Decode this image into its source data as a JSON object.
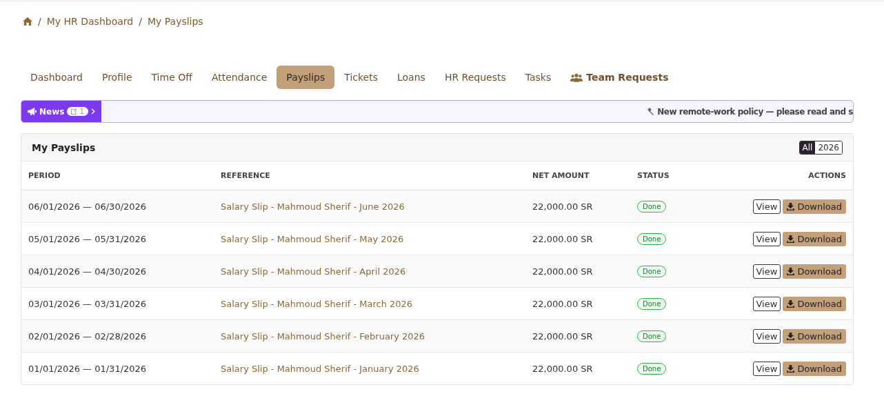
{
  "breadcrumb": [
    {
      "separator": "/",
      "label": "My HR Dashboard"
    },
    {
      "separator": "/",
      "label": "My Payslips"
    }
  ],
  "tabs": [
    {
      "label": "Dashboard",
      "selected": false,
      "kind": "plain"
    },
    {
      "label": "Profile",
      "selected": false,
      "kind": "plain"
    },
    {
      "label": "Time Off",
      "selected": false,
      "kind": "plain"
    },
    {
      "label": "Attendance",
      "selected": false,
      "kind": "plain"
    },
    {
      "label": "Payslips",
      "selected": true,
      "kind": "plain"
    },
    {
      "label": "Tickets",
      "selected": false,
      "kind": "plain"
    },
    {
      "label": "Loans",
      "selected": false,
      "kind": "plain"
    },
    {
      "label": "HR Requests",
      "selected": false,
      "kind": "plain"
    },
    {
      "label": "Tasks",
      "selected": false,
      "kind": "plain"
    },
    {
      "label": "Team Requests",
      "selected": false,
      "kind": "team"
    }
  ],
  "news": {
    "label": "News",
    "count": "1",
    "ticker": "New remote-work policy — please read and s"
  },
  "card": {
    "title": "My Payslips",
    "filters": [
      {
        "label": "All",
        "selected": true
      },
      {
        "label": "2026",
        "selected": false
      }
    ]
  },
  "table": {
    "columns": [
      "PERIOD",
      "REFERENCE",
      "NET AMOUNT",
      "STATUS",
      "ACTIONS"
    ],
    "rows": [
      {
        "period": "06/01/2026 — 06/30/2026",
        "reference": "Salary Slip - Mahmoud Sherif - June 2026",
        "amount": "22,000.00 SR",
        "status": "Done",
        "view": "View",
        "download": "Download"
      },
      {
        "period": "05/01/2026 — 05/31/2026",
        "reference": "Salary Slip - Mahmoud Sherif - May 2026",
        "amount": "22,000.00 SR",
        "status": "Done",
        "view": "View",
        "download": "Download"
      },
      {
        "period": "04/01/2026 — 04/30/2026",
        "reference": "Salary Slip - Mahmoud Sherif - April 2026",
        "amount": "22,000.00 SR",
        "status": "Done",
        "view": "View",
        "download": "Download"
      },
      {
        "period": "03/01/2026 — 03/31/2026",
        "reference": "Salary Slip - Mahmoud Sherif - March 2026",
        "amount": "22,000.00 SR",
        "status": "Done",
        "view": "View",
        "download": "Download"
      },
      {
        "period": "02/01/2026 — 02/28/2026",
        "reference": "Salary Slip - Mahmoud Sherif - February 2026",
        "amount": "22,000.00 SR",
        "status": "Done",
        "view": "View",
        "download": "Download"
      },
      {
        "period": "01/01/2026 — 01/31/2026",
        "reference": "Salary Slip - Mahmoud Sherif - January 2026",
        "amount": "22,000.00 SR",
        "status": "Done",
        "view": "View",
        "download": "Download"
      }
    ]
  }
}
